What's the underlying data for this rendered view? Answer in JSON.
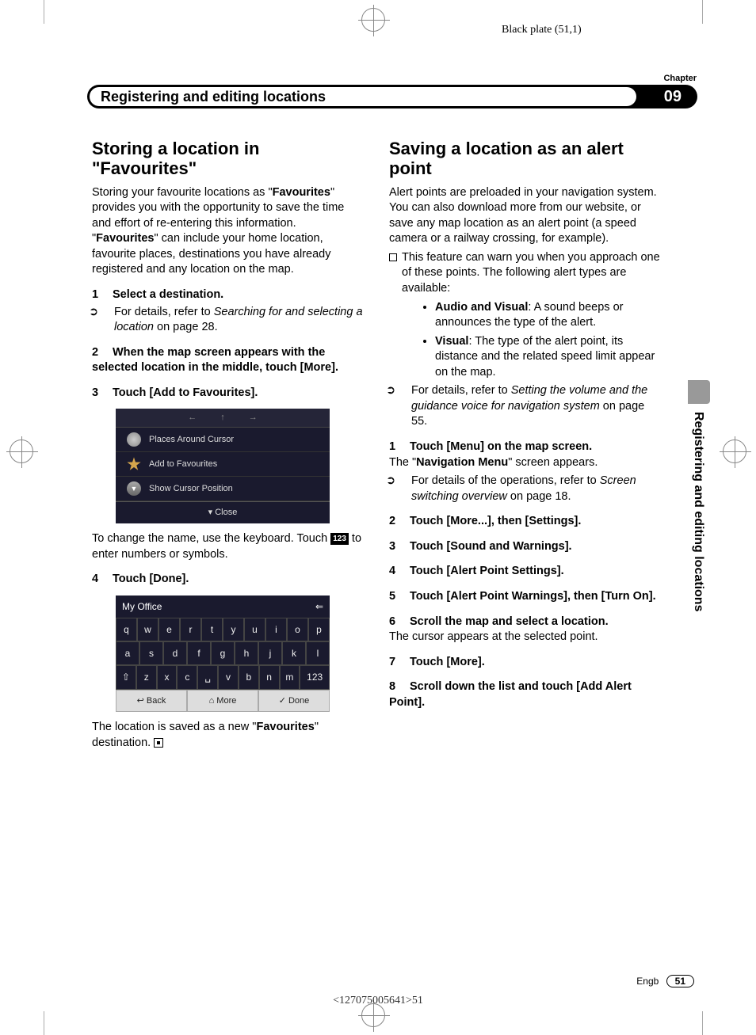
{
  "black_plate": "Black plate (51,1)",
  "chapter_label": "Chapter",
  "chapter_title": "Registering and editing locations",
  "chapter_number": "09",
  "side_tab": "Registering and editing locations",
  "left": {
    "heading": "Storing a location in \"Favourites\"",
    "intro_1": "Storing your favourite locations as \"",
    "intro_bold1": "Favourites",
    "intro_2": "\" provides you with the opportunity to save the time and effort of re-entering this information. \"",
    "intro_bold2": "Favourites",
    "intro_3": "\" can include your home location, favourite places, destinations you have already registered and any location on the map.",
    "step1": "Select a destination.",
    "step1_sub_a": "For details, refer to ",
    "step1_sub_i": "Searching for and selecting a location",
    "step1_sub_b": " on page 28.",
    "step2": "When the map screen appears with the selected location in the middle, touch [More].",
    "step3": "Touch [Add to Favourites].",
    "screenshot1": {
      "opts": [
        "Places Around Cursor",
        "Add to Favourites",
        "Show Cursor Position"
      ],
      "close": "Close"
    },
    "mid_text_a": "To change the name, use the keyboard. Touch ",
    "mid_badge": "123",
    "mid_text_b": " to enter numbers or symbols.",
    "step4": "Touch [Done].",
    "screenshot2": {
      "title": "My Office",
      "row1": [
        "q",
        "w",
        "e",
        "r",
        "t",
        "y",
        "u",
        "i",
        "o",
        "p"
      ],
      "row2": [
        "a",
        "s",
        "d",
        "f",
        "g",
        "h",
        "j",
        "k",
        "l"
      ],
      "row3": [
        "⇧",
        "z",
        "x",
        "c",
        "␣",
        "v",
        "b",
        "n",
        "m",
        "123"
      ],
      "btns": [
        "↩ Back",
        "⌂ More",
        "✓ Done"
      ]
    },
    "outro_a": "The location is saved as a new \"",
    "outro_bold": "Favourites",
    "outro_b": "\" destination."
  },
  "right": {
    "heading": "Saving a location as an alert point",
    "intro": "Alert points are preloaded in your navigation system. You can also download more from our website, or save any map location as an alert point (a speed camera or a railway crossing, for example).",
    "note1": "This feature can warn you when you approach one of these points. The following alert types are available:",
    "bullet1_label": "Audio and Visual",
    "bullet1_text": ": A sound beeps or announces the type of the alert.",
    "bullet2_label": "Visual",
    "bullet2_text": ": The type of the alert point, its distance and the related speed limit appear on the map.",
    "sub2_a": "For details, refer to ",
    "sub2_i": "Setting the volume and the guidance voice for navigation system",
    "sub2_b": " on page 55.",
    "step1": "Touch [Menu] on the map screen.",
    "step1_after_a": "The \"",
    "step1_after_bold": "Navigation Menu",
    "step1_after_b": "\" screen appears.",
    "step1_sub_a": "For details of the operations, refer to ",
    "step1_sub_i": "Screen switching overview",
    "step1_sub_b": " on page 18.",
    "step2": "Touch [More...], then [Settings].",
    "step3": "Touch [Sound and Warnings].",
    "step4": "Touch [Alert Point Settings].",
    "step5": "Touch [Alert Point Warnings], then [Turn On].",
    "step6": "Scroll the map and select a location.",
    "step6_after": "The cursor appears at the selected point.",
    "step7": "Touch [More].",
    "step8": "Scroll down the list and touch [Add Alert Point]."
  },
  "footer_lang": "Engb",
  "footer_page": "51",
  "footer_code": "<127075005641>51"
}
